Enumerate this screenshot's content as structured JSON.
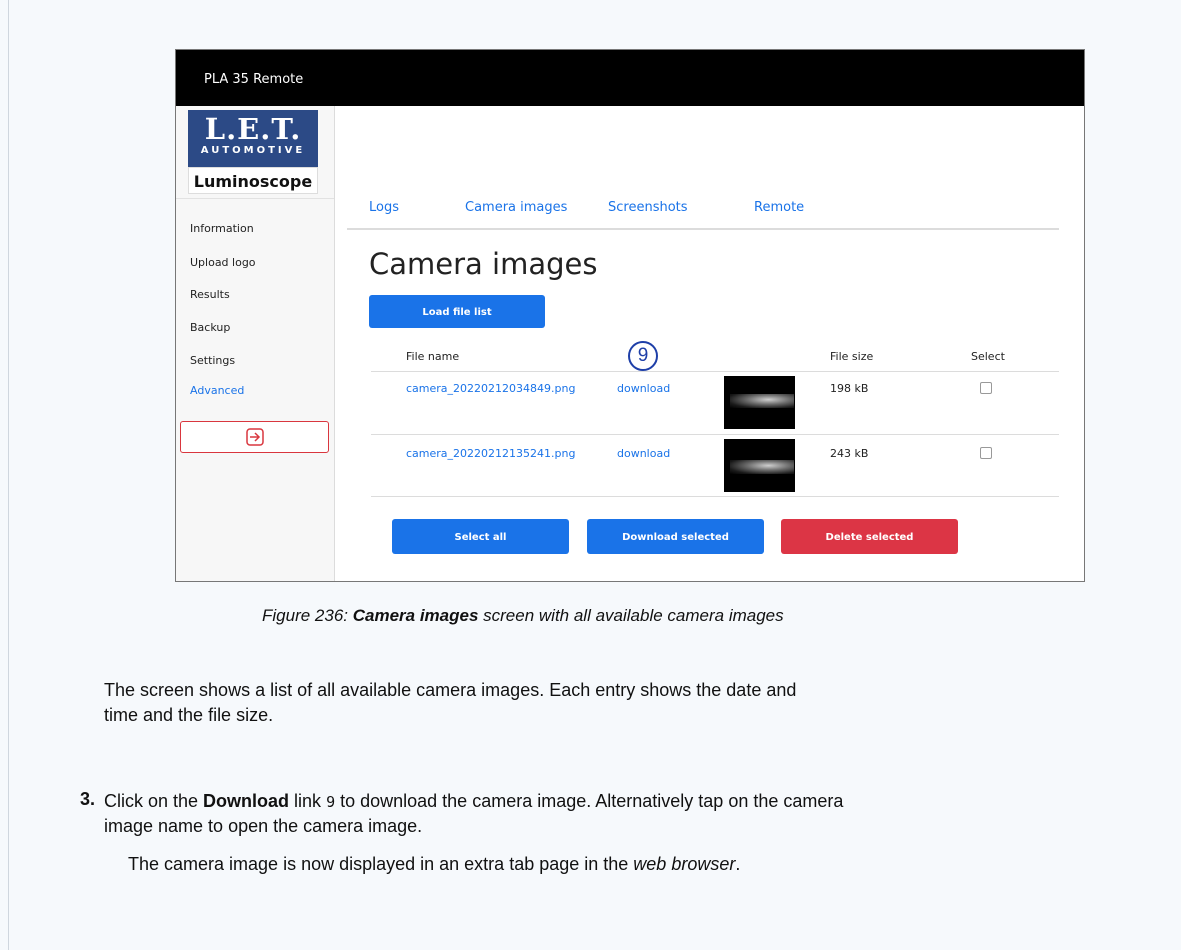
{
  "app": {
    "title": "PLA 35 Remote"
  },
  "logo": {
    "top": "L.E.T.",
    "sub": "AUTOMOTIVE",
    "brand": "Luminoscope"
  },
  "sidebar": {
    "items": [
      {
        "label": "Information"
      },
      {
        "label": "Upload logo"
      },
      {
        "label": "Results"
      },
      {
        "label": "Backup"
      },
      {
        "label": "Settings"
      },
      {
        "label": "Advanced",
        "active": true
      }
    ],
    "logout_icon": "logout-icon"
  },
  "tabs": [
    {
      "label": "Logs"
    },
    {
      "label": "Camera images"
    },
    {
      "label": "Screenshots"
    },
    {
      "label": "Remote"
    }
  ],
  "main": {
    "heading": "Camera images",
    "load_button": "Load file list",
    "columns": {
      "file_name": "File name",
      "file_size": "File size",
      "select": "Select"
    },
    "rows": [
      {
        "file": "camera_20220212034849.png",
        "action": "download",
        "size": "198 kB",
        "selected": false
      },
      {
        "file": "camera_20220212135241.png",
        "action": "download",
        "size": "243 kB",
        "selected": false
      }
    ],
    "buttons": {
      "select_all": "Select all",
      "download_selected": "Download selected",
      "delete_selected": "Delete selected"
    },
    "callout": "9"
  },
  "doc": {
    "caption_prefix": "Figure 236: ",
    "caption_bold": "Camera images",
    "caption_suffix": " screen with all available camera images",
    "para1_line1": "The screen shows a list of all available camera images. Each entry shows the date and",
    "para1_line2": "time and the file size.",
    "step_number": "3.",
    "step_pre": "Click on the ",
    "step_bold": "Download",
    "step_mid": " link ",
    "step_ref": "9",
    "step_post": " to download the camera image. Alternatively tap on the camera",
    "step_line2": "image name to open the camera image.",
    "result_pre": "The camera image is now displayed in an extra tab page in the ",
    "result_italic": "web browser",
    "result_post": "."
  },
  "colors": {
    "accent": "#1a73e8",
    "danger": "#dc3545",
    "topbar": "#000000",
    "logo_blue": "#2c4a86"
  }
}
